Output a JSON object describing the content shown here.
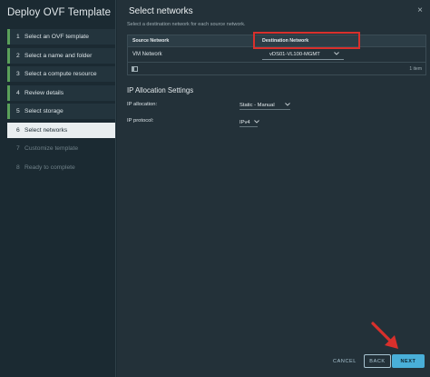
{
  "sidebar": {
    "title": "Deploy OVF Template",
    "steps": [
      {
        "num": "1",
        "label": "Select an OVF template",
        "state": "done"
      },
      {
        "num": "2",
        "label": "Select a name and folder",
        "state": "done"
      },
      {
        "num": "3",
        "label": "Select a compute resource",
        "state": "done"
      },
      {
        "num": "4",
        "label": "Review details",
        "state": "done"
      },
      {
        "num": "5",
        "label": "Select storage",
        "state": "done"
      },
      {
        "num": "6",
        "label": "Select networks",
        "state": "active"
      },
      {
        "num": "7",
        "label": "Customize template",
        "state": "pending"
      },
      {
        "num": "8",
        "label": "Ready to complete",
        "state": "pending"
      }
    ]
  },
  "main": {
    "title": "Select networks",
    "close_glyph": "×",
    "subtitle": "Select a destination network for each source network.",
    "table": {
      "headers": [
        "Source Network",
        "Destination Network"
      ],
      "rows": [
        {
          "source": "VM Network",
          "destination": "vDS01-VL100-MGMT"
        }
      ],
      "footer_count": "1 item"
    },
    "ip_settings": {
      "title": "IP Allocation Settings",
      "allocation_label": "IP allocation:",
      "allocation_value": "Static - Manual",
      "protocol_label": "IP protocol:",
      "protocol_value": "IPv4"
    },
    "buttons": {
      "cancel": "CANCEL",
      "back": "BACK",
      "next": "NEXT"
    }
  },
  "colors": {
    "highlight_box": "#d8302c",
    "next_button": "#49afd9",
    "done_marker": "#5aa05a"
  },
  "icons": {
    "close": "close-icon",
    "chevron": "chevron-down-icon",
    "column_toggle": "column-toggle-icon",
    "annotation_arrow": "red-arrow-annotation"
  }
}
